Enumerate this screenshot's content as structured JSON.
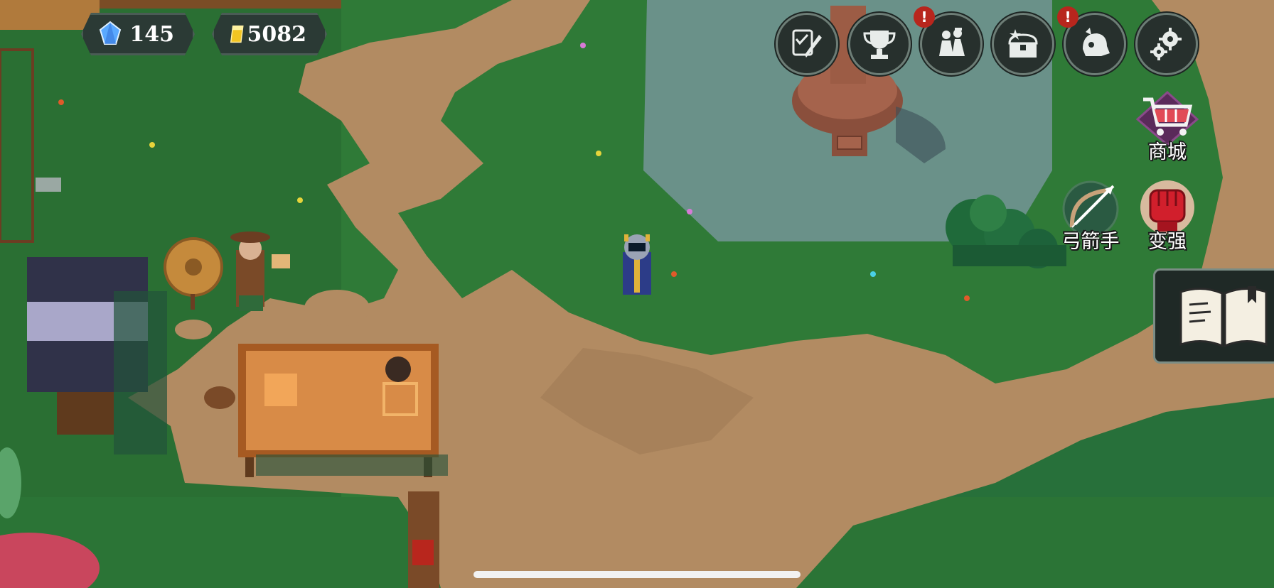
{
  "hud": {
    "gems": {
      "value": "145",
      "icon": "blue-crystal-icon"
    },
    "gold": {
      "value": "5082",
      "icon": "gold-bar-icon"
    }
  },
  "top_buttons": [
    {
      "name": "quest-button",
      "icon": "checklist-quill-icon",
      "alert": false
    },
    {
      "name": "trophy-button",
      "icon": "trophy-icon",
      "alert": true
    },
    {
      "name": "characters-button",
      "icon": "heroes-icon",
      "alert": true
    },
    {
      "name": "treasure-button",
      "icon": "treasure-chest-icon",
      "alert": false
    },
    {
      "name": "pet-button",
      "icon": "helmet-beast-icon",
      "alert": true
    },
    {
      "name": "settings-button",
      "icon": "gear-icon",
      "alert": false
    }
  ],
  "alert_mark": "!",
  "side_buttons": {
    "shop": {
      "label": "商城",
      "icon": "shopping-cart-icon"
    },
    "archer": {
      "label": "弓箭手",
      "icon": "bow-arrow-icon"
    },
    "upgrade": {
      "label": "变强",
      "icon": "red-fist-icon"
    }
  },
  "journal_button": {
    "icon": "open-book-icon"
  },
  "colors": {
    "grass": "#2f7a37",
    "grass_dark": "#1f5e2e",
    "path": "#b28b62",
    "hud_bg": "#2b3a35",
    "alert": "#b8261d"
  }
}
